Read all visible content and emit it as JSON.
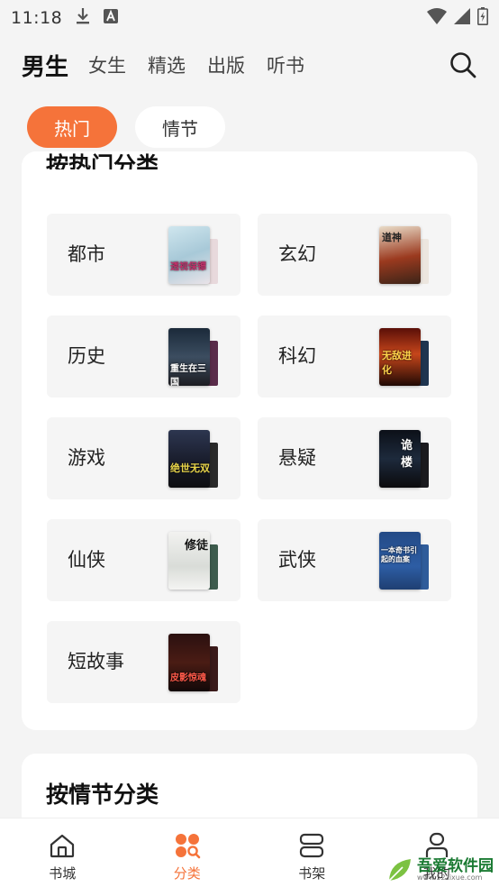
{
  "status_bar": {
    "time": "11:18"
  },
  "nav": {
    "tabs": [
      "男生",
      "女生",
      "精选",
      "出版",
      "听书"
    ],
    "active_index": 0
  },
  "chips": [
    {
      "label": "热门",
      "active": true
    },
    {
      "label": "情节",
      "active": false
    }
  ],
  "hot_section": {
    "title": "按热门分类",
    "categories": [
      {
        "label": "都市",
        "cover_title": "透视保镖"
      },
      {
        "label": "玄幻",
        "cover_title": "道神"
      },
      {
        "label": "历史",
        "cover_title": "重生在三国"
      },
      {
        "label": "科幻",
        "cover_title": "无敌进化"
      },
      {
        "label": "游戏",
        "cover_title": "绝世无双"
      },
      {
        "label": "悬疑",
        "cover_title": "诡楼"
      },
      {
        "label": "仙侠",
        "cover_title": "修徒"
      },
      {
        "label": "武侠",
        "cover_title": "一本奇书引起的血案"
      },
      {
        "label": "短故事",
        "cover_title": "皮影惊魂"
      }
    ]
  },
  "plot_section": {
    "title": "按情节分类"
  },
  "tabbar": {
    "items": [
      {
        "label": "书城",
        "icon": "home-icon"
      },
      {
        "label": "分类",
        "icon": "category-icon"
      },
      {
        "label": "书架",
        "icon": "bookshelf-icon"
      },
      {
        "label": "我的",
        "icon": "profile-icon"
      }
    ],
    "active_index": 1
  },
  "watermark": {
    "text": "吾爱软件园",
    "url": "www.52zixue.com"
  },
  "colors": {
    "accent": "#f5733a",
    "background": "#f4f4f4",
    "card": "#ffffff",
    "tile": "#f5f5f5"
  }
}
